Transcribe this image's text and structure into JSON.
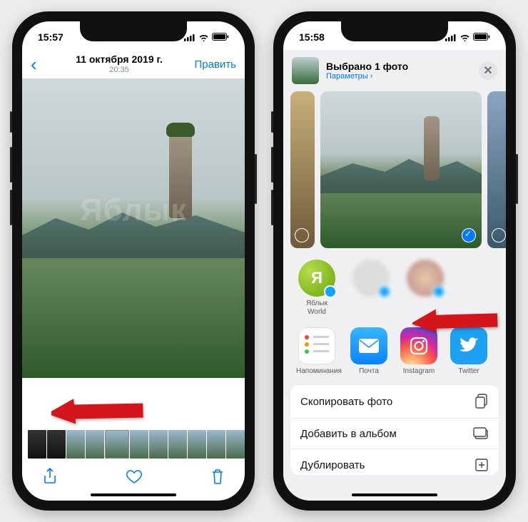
{
  "watermark": "Яблык",
  "left": {
    "status": {
      "time": "15:57"
    },
    "header": {
      "date": "11 октября 2019 г.",
      "time": "20:35",
      "edit": "Править"
    },
    "toolbar": {
      "share": "share-icon",
      "heart": "heart-icon",
      "trash": "trash-icon"
    }
  },
  "right": {
    "status": {
      "time": "15:58"
    },
    "sheet": {
      "title": "Выбрано 1 фото",
      "options": "Параметры",
      "chevron": "›",
      "close": "✕"
    },
    "airdrop": [
      {
        "label": "Яблык World"
      },
      {
        "label": ""
      },
      {
        "label": ""
      }
    ],
    "apps": [
      {
        "label": "Напоминания"
      },
      {
        "label": "Почта"
      },
      {
        "label": "Instagram"
      },
      {
        "label": "Twitter"
      },
      {
        "label": ""
      }
    ],
    "actions": [
      {
        "label": "Скопировать фото"
      },
      {
        "label": "Добавить в альбом"
      },
      {
        "label": "Дублировать"
      }
    ]
  }
}
